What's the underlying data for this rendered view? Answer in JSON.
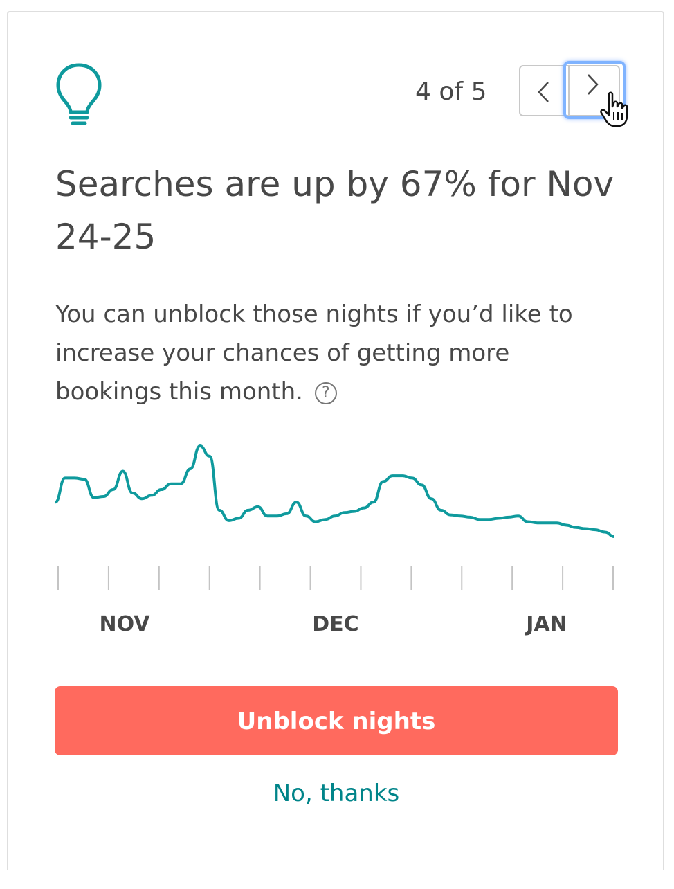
{
  "pager": {
    "count_label": "4 of 5",
    "current": 4,
    "total": 5
  },
  "title": "Searches are up by 67% for Nov 24-25",
  "body": "You can unblock those nights if you’d like to increase your chances of getting more bookings this month.",
  "help_icon_glyph": "?",
  "icons": [
    "lightbulb-icon",
    "chevron-left-icon",
    "chevron-right-icon",
    "hand-cursor-icon",
    "help-icon"
  ],
  "colors": {
    "accent": "#008489",
    "cta": "#ff6a5e",
    "line": "#0f9a9d",
    "text": "#484848"
  },
  "chart_data": {
    "type": "line",
    "title": "",
    "xlabel": "",
    "ylabel": "",
    "month_labels": [
      "NOV",
      "DEC",
      "JAN"
    ],
    "tick_count": 12,
    "grid": false,
    "legend": "none",
    "series": [
      {
        "values": [
          0.45,
          0.66,
          0.66,
          0.65,
          0.49,
          0.5,
          0.56,
          0.72,
          0.53,
          0.48,
          0.51,
          0.56,
          0.61,
          0.61,
          0.74,
          0.94,
          0.85,
          0.38,
          0.29,
          0.31,
          0.38,
          0.41,
          0.33,
          0.33,
          0.35,
          0.45,
          0.33,
          0.28,
          0.3,
          0.33,
          0.36,
          0.37,
          0.4,
          0.45,
          0.63,
          0.68,
          0.68,
          0.66,
          0.6,
          0.48,
          0.38,
          0.34,
          0.33,
          0.32,
          0.3,
          0.3,
          0.31,
          0.32,
          0.33,
          0.28,
          0.27,
          0.27,
          0.27,
          0.25,
          0.23,
          0.22,
          0.21,
          0.19,
          0.15
        ]
      }
    ]
  },
  "cta_label": "Unblock nights",
  "dismiss_label": "No, thanks"
}
